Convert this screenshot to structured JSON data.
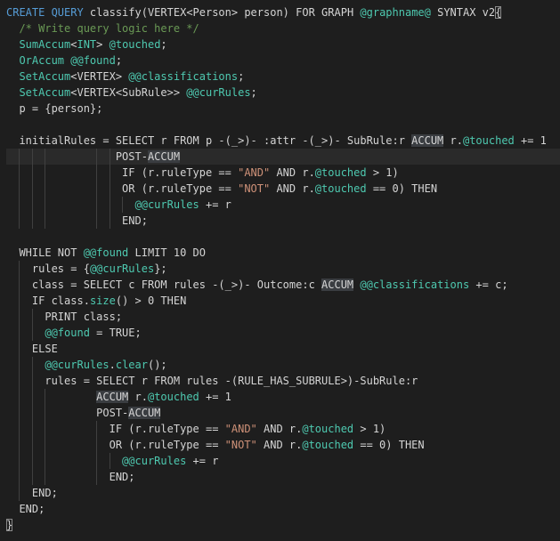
{
  "colors": {
    "background": "#1e1e1e",
    "keyword": "#569cd6",
    "comment": "#6a9955",
    "string": "#ce9178",
    "number": "#b5cea8",
    "accumulator": "#4ec9b0",
    "function": "#dcdcaa",
    "text": "#d4d4d4"
  },
  "lines": [
    {
      "indent": 0,
      "tokens": [
        {
          "t": "CREATE QUERY ",
          "c": "kw"
        },
        {
          "t": "classify",
          "c": "plain"
        },
        {
          "t": "(",
          "c": "plain"
        },
        {
          "t": "VERTEX",
          "c": "plain"
        },
        {
          "t": "<Person> person) ",
          "c": "plain"
        },
        {
          "t": "FOR GRAPH ",
          "c": "plain"
        },
        {
          "t": "@graphname@",
          "c": "acc"
        },
        {
          "t": " SYNTAX v2",
          "c": "plain"
        },
        {
          "t": "{",
          "c": "plain",
          "mark": "bm"
        }
      ]
    },
    {
      "indent": 2,
      "tokens": [
        {
          "t": "/* Write query logic here */",
          "c": "cm"
        }
      ]
    },
    {
      "indent": 2,
      "tokens": [
        {
          "t": "SumAccum",
          "c": "acc"
        },
        {
          "t": "<",
          "c": "plain"
        },
        {
          "t": "INT",
          "c": "acc"
        },
        {
          "t": "> ",
          "c": "plain"
        },
        {
          "t": "@touched",
          "c": "acc"
        },
        {
          "t": ";",
          "c": "plain"
        }
      ]
    },
    {
      "indent": 2,
      "tokens": [
        {
          "t": "OrAccum ",
          "c": "acc"
        },
        {
          "t": "@@found",
          "c": "acc"
        },
        {
          "t": ";",
          "c": "plain"
        }
      ]
    },
    {
      "indent": 2,
      "tokens": [
        {
          "t": "SetAccum",
          "c": "acc"
        },
        {
          "t": "<VERTEX> ",
          "c": "plain"
        },
        {
          "t": "@@classifications",
          "c": "acc"
        },
        {
          "t": ";",
          "c": "plain"
        }
      ]
    },
    {
      "indent": 2,
      "tokens": [
        {
          "t": "SetAccum",
          "c": "acc"
        },
        {
          "t": "<VERTEX<SubRule>> ",
          "c": "plain"
        },
        {
          "t": "@@curRules",
          "c": "acc"
        },
        {
          "t": ";",
          "c": "plain"
        }
      ]
    },
    {
      "indent": 2,
      "tokens": [
        {
          "t": "p = {person};",
          "c": "plain"
        }
      ]
    },
    {
      "indent": 0,
      "tokens": []
    },
    {
      "indent": 2,
      "tokens": [
        {
          "t": "initialRules = SELECT r FROM p -(_>)- :attr -(_>)- SubRule:r ",
          "c": "plain"
        },
        {
          "t": "ACCUM",
          "c": "plain",
          "mark": "hl"
        },
        {
          "t": " r.",
          "c": "plain"
        },
        {
          "t": "@touched",
          "c": "acc"
        },
        {
          "t": " += 1",
          "c": "plain"
        }
      ]
    },
    {
      "indent": 17,
      "tokens": [
        {
          "t": "POST-",
          "c": "plain"
        },
        {
          "t": "ACCUM",
          "c": "plain",
          "mark": "hl"
        }
      ],
      "current": true
    },
    {
      "indent": 18,
      "tokens": [
        {
          "t": "IF (r.ruleType == ",
          "c": "plain"
        },
        {
          "t": "\"AND\"",
          "c": "str"
        },
        {
          "t": " AND r.",
          "c": "plain"
        },
        {
          "t": "@touched",
          "c": "acc"
        },
        {
          "t": " > 1)",
          "c": "plain"
        }
      ]
    },
    {
      "indent": 18,
      "tokens": [
        {
          "t": "OR (r.ruleType == ",
          "c": "plain"
        },
        {
          "t": "\"NOT\"",
          "c": "str"
        },
        {
          "t": " AND r.",
          "c": "plain"
        },
        {
          "t": "@touched",
          "c": "acc"
        },
        {
          "t": " == 0) THEN",
          "c": "plain"
        }
      ]
    },
    {
      "indent": 20,
      "tokens": [
        {
          "t": "@@curRules",
          "c": "acc"
        },
        {
          "t": " += r",
          "c": "plain"
        }
      ]
    },
    {
      "indent": 18,
      "tokens": [
        {
          "t": "END;",
          "c": "plain"
        }
      ]
    },
    {
      "indent": 0,
      "tokens": []
    },
    {
      "indent": 2,
      "tokens": [
        {
          "t": "WHILE NOT ",
          "c": "plain"
        },
        {
          "t": "@@found",
          "c": "acc"
        },
        {
          "t": " LIMIT 10 DO",
          "c": "plain"
        }
      ]
    },
    {
      "indent": 4,
      "tokens": [
        {
          "t": "rules = {",
          "c": "plain"
        },
        {
          "t": "@@curRules",
          "c": "acc"
        },
        {
          "t": "};",
          "c": "plain"
        }
      ]
    },
    {
      "indent": 4,
      "tokens": [
        {
          "t": "class = SELECT c FROM rules -(_>)- Outcome:c ",
          "c": "plain"
        },
        {
          "t": "ACCUM",
          "c": "plain",
          "mark": "hl"
        },
        {
          "t": " ",
          "c": "plain"
        },
        {
          "t": "@@classifications",
          "c": "acc"
        },
        {
          "t": " += c;",
          "c": "plain"
        }
      ]
    },
    {
      "indent": 4,
      "tokens": [
        {
          "t": "IF class.",
          "c": "plain"
        },
        {
          "t": "size",
          "c": "acc"
        },
        {
          "t": "() > 0 THEN",
          "c": "plain"
        }
      ]
    },
    {
      "indent": 6,
      "tokens": [
        {
          "t": "PRINT class;",
          "c": "plain"
        }
      ]
    },
    {
      "indent": 6,
      "tokens": [
        {
          "t": "@@found",
          "c": "acc"
        },
        {
          "t": " = TRUE;",
          "c": "plain"
        }
      ]
    },
    {
      "indent": 4,
      "tokens": [
        {
          "t": "ELSE",
          "c": "plain"
        }
      ]
    },
    {
      "indent": 6,
      "tokens": [
        {
          "t": "@@curRules",
          "c": "acc"
        },
        {
          "t": ".",
          "c": "plain"
        },
        {
          "t": "clear",
          "c": "acc"
        },
        {
          "t": "();",
          "c": "plain"
        }
      ]
    },
    {
      "indent": 6,
      "tokens": [
        {
          "t": "rules = SELECT r FROM rules -(RULE_HAS_SUBRULE>)-SubRule:r",
          "c": "plain"
        }
      ]
    },
    {
      "indent": 14,
      "tokens": [
        {
          "t": "ACCUM",
          "c": "plain",
          "mark": "hl"
        },
        {
          "t": " r.",
          "c": "plain"
        },
        {
          "t": "@touched",
          "c": "acc"
        },
        {
          "t": " += 1",
          "c": "plain"
        }
      ]
    },
    {
      "indent": 14,
      "tokens": [
        {
          "t": "POST-",
          "c": "plain"
        },
        {
          "t": "ACCUM",
          "c": "plain",
          "mark": "hl"
        }
      ]
    },
    {
      "indent": 16,
      "tokens": [
        {
          "t": "IF (r.ruleType == ",
          "c": "plain"
        },
        {
          "t": "\"AND\"",
          "c": "str"
        },
        {
          "t": " AND r.",
          "c": "plain"
        },
        {
          "t": "@touched",
          "c": "acc"
        },
        {
          "t": " > 1)",
          "c": "plain"
        }
      ]
    },
    {
      "indent": 16,
      "tokens": [
        {
          "t": "OR (r.ruleType == ",
          "c": "plain"
        },
        {
          "t": "\"NOT\"",
          "c": "str"
        },
        {
          "t": " AND r.",
          "c": "plain"
        },
        {
          "t": "@touched",
          "c": "acc"
        },
        {
          "t": " == 0) THEN",
          "c": "plain"
        }
      ]
    },
    {
      "indent": 18,
      "tokens": [
        {
          "t": "@@curRules",
          "c": "acc"
        },
        {
          "t": " += r",
          "c": "plain"
        }
      ]
    },
    {
      "indent": 16,
      "tokens": [
        {
          "t": "END;",
          "c": "plain"
        }
      ]
    },
    {
      "indent": 4,
      "tokens": [
        {
          "t": "END;",
          "c": "plain"
        }
      ]
    },
    {
      "indent": 2,
      "tokens": [
        {
          "t": "END;",
          "c": "plain"
        }
      ]
    },
    {
      "indent": 0,
      "tokens": [
        {
          "t": "}",
          "c": "plain",
          "mark": "bm"
        }
      ]
    }
  ]
}
